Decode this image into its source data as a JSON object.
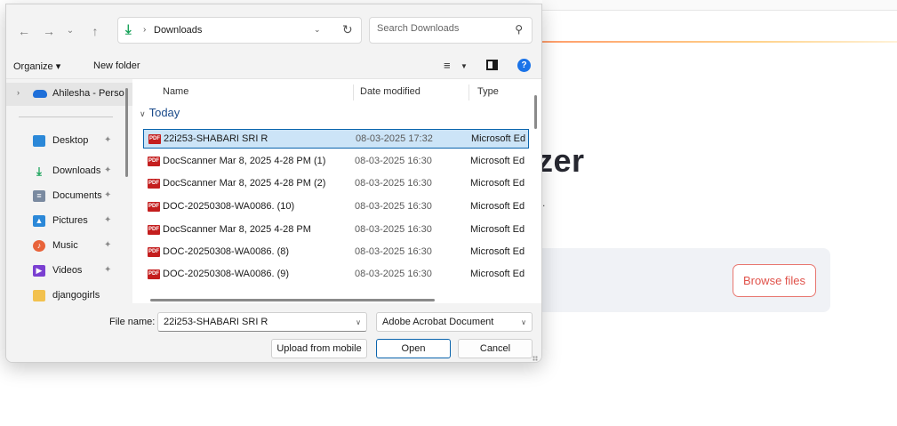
{
  "background_page": {
    "heading_fragment": "zer",
    "subtitle_fragment": "s.",
    "browse_button": "Browse files"
  },
  "dialog": {
    "address": {
      "path": "Downloads",
      "folder_icon": "download-arrow-icon",
      "separator": "›"
    },
    "search": {
      "placeholder": "Search Downloads"
    },
    "command_bar": {
      "organize": "Organize ▾",
      "new_folder": "New folder"
    },
    "nav_pane": {
      "onedrive": "Ahilesha - Perso",
      "items": [
        {
          "label": "Desktop",
          "icon": "desktop-icon",
          "color": "#2b88d8"
        },
        {
          "label": "Downloads",
          "icon": "download-icon",
          "color": "#19a35a"
        },
        {
          "label": "Documents",
          "icon": "documents-icon",
          "color": "#7a8aa0"
        },
        {
          "label": "Pictures",
          "icon": "pictures-icon",
          "color": "#2b88d8"
        },
        {
          "label": "Music",
          "icon": "music-icon",
          "color": "#e8633a"
        },
        {
          "label": "Videos",
          "icon": "videos-icon",
          "color": "#7a3fd1"
        },
        {
          "label": "djangogirls",
          "icon": "folder-icon",
          "color": "#f2c14e"
        }
      ]
    },
    "columns": {
      "name": "Name",
      "date": "Date modified",
      "type": "Type"
    },
    "group": "Today",
    "files": [
      {
        "name": "22i253-SHABARI SRI R",
        "date": "08-03-2025 17:32",
        "type": "Microsoft Ed",
        "selected": true
      },
      {
        "name": "DocScanner Mar 8, 2025 4-28 PM (1)",
        "date": "08-03-2025 16:30",
        "type": "Microsoft Ed",
        "selected": false
      },
      {
        "name": "DocScanner Mar 8, 2025 4-28 PM (2)",
        "date": "08-03-2025 16:30",
        "type": "Microsoft Ed",
        "selected": false
      },
      {
        "name": "DOC-20250308-WA0086. (10)",
        "date": "08-03-2025 16:30",
        "type": "Microsoft Ed",
        "selected": false
      },
      {
        "name": "DocScanner Mar 8, 2025 4-28 PM",
        "date": "08-03-2025 16:30",
        "type": "Microsoft Ed",
        "selected": false
      },
      {
        "name": "DOC-20250308-WA0086. (8)",
        "date": "08-03-2025 16:30",
        "type": "Microsoft Ed",
        "selected": false
      },
      {
        "name": "DOC-20250308-WA0086. (9)",
        "date": "08-03-2025 16:30",
        "type": "Microsoft Ed",
        "selected": false
      }
    ],
    "file_icon_text": "PDF",
    "file_name_label": "File name:",
    "file_name_value": "22i253-SHABARI SRI R",
    "file_type_value": "Adobe Acrobat Document",
    "buttons": {
      "upload_mobile": "Upload from mobile",
      "open": "Open",
      "cancel": "Cancel"
    }
  }
}
